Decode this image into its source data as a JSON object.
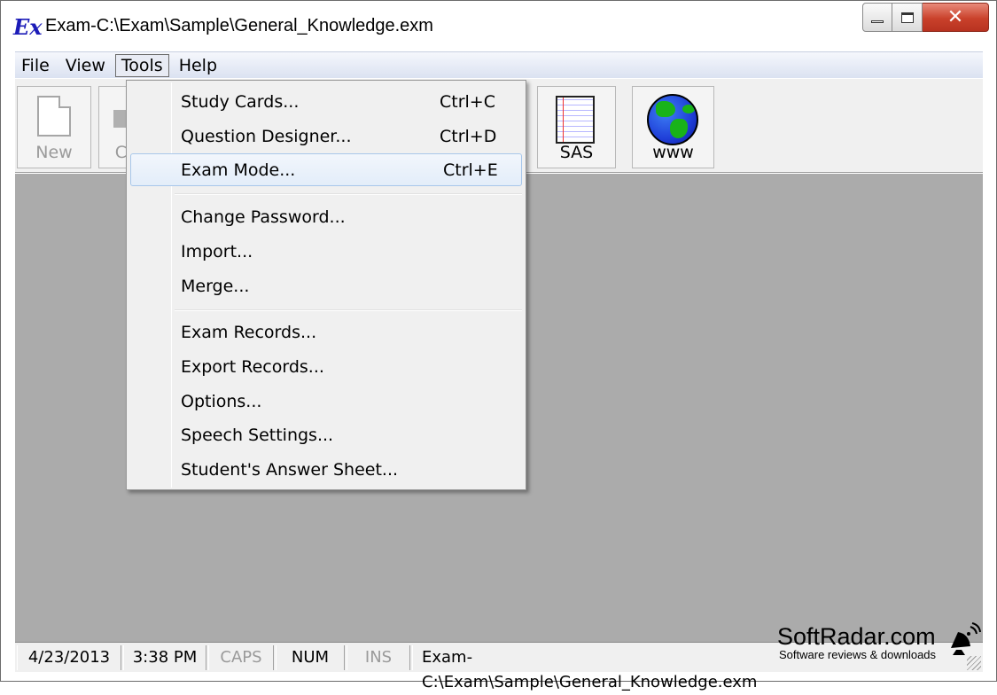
{
  "window": {
    "app_icon_text": "Ex",
    "title": "Exam-C:\\Exam\\Sample\\General_Knowledge.exm"
  },
  "menubar": {
    "items": [
      "File",
      "View",
      "Tools",
      "Help"
    ],
    "active": "Tools"
  },
  "toolbar": {
    "new_label": "New",
    "partial_label": "C",
    "sas_label": "SAS",
    "www_label": "www"
  },
  "tools_menu": {
    "items": [
      {
        "label": "Study Cards...",
        "shortcut": "Ctrl+C"
      },
      {
        "label": "Question Designer...",
        "shortcut": "Ctrl+D"
      },
      {
        "label": "Exam Mode...",
        "shortcut": "Ctrl+E",
        "highlighted": true
      },
      {
        "label": "Change Password...",
        "shortcut": ""
      },
      {
        "label": "Import...",
        "shortcut": ""
      },
      {
        "label": "Merge...",
        "shortcut": ""
      },
      {
        "label": "Exam Records...",
        "shortcut": ""
      },
      {
        "label": "Export Records...",
        "shortcut": ""
      },
      {
        "label": "Options...",
        "shortcut": ""
      },
      {
        "label": "Speech Settings...",
        "shortcut": ""
      },
      {
        "label": "Student's Answer Sheet...",
        "shortcut": ""
      }
    ]
  },
  "statusbar": {
    "date": "4/23/2013",
    "time": "3:38 PM",
    "caps": "CAPS",
    "num": "NUM",
    "ins": "INS",
    "path": "Exam-C:\\Exam\\Sample\\General_Knowledge.exm"
  },
  "watermark": {
    "title": "SoftRadar.com",
    "subtitle": "Software reviews & downloads"
  },
  "colors": {
    "client_bg": "#ababab",
    "menu_hover_border": "#a8c7ea",
    "close_button": "#c9412b"
  }
}
